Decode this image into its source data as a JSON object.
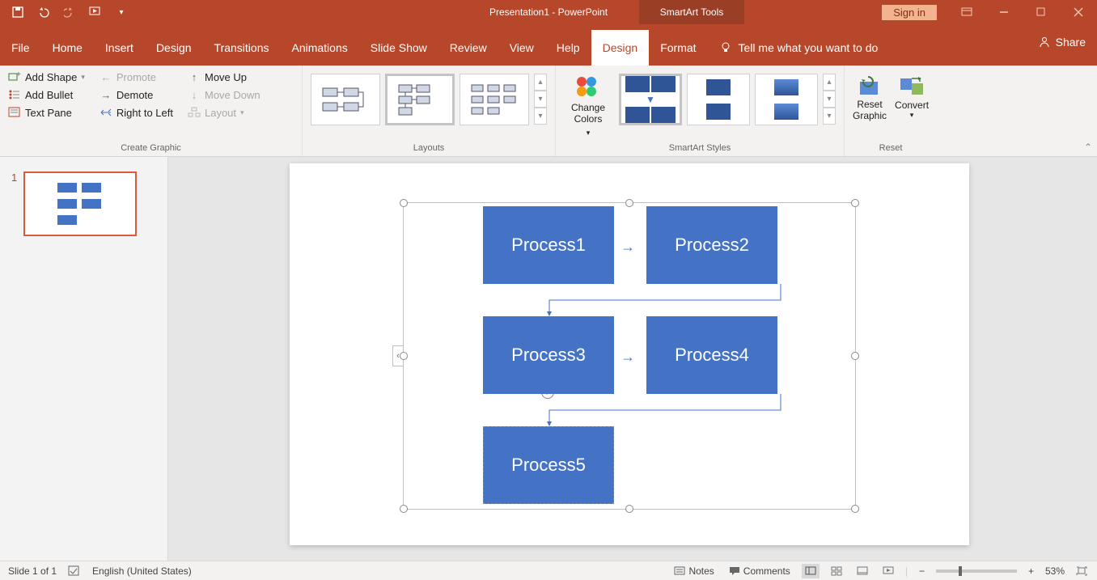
{
  "titlebar": {
    "filename": "Presentation1",
    "app": " - PowerPoint",
    "contextTab": "SmartArt Tools",
    "signin": "Sign in"
  },
  "tabs": {
    "file": "File",
    "home": "Home",
    "insert": "Insert",
    "design_main": "Design",
    "transitions": "Transitions",
    "animations": "Animations",
    "slideshow": "Slide Show",
    "review": "Review",
    "view": "View",
    "help": "Help",
    "sa_design": "Design",
    "sa_format": "Format",
    "tellme": "Tell me what you want to do",
    "share": "Share"
  },
  "ribbon": {
    "createGraphic": {
      "label": "Create Graphic",
      "addShape": "Add Shape",
      "addBullet": "Add Bullet",
      "textPane": "Text Pane",
      "promote": "Promote",
      "demote": "Demote",
      "rightToLeft": "Right to Left",
      "moveUp": "Move Up",
      "moveDown": "Move Down",
      "layout": "Layout"
    },
    "layouts": {
      "label": "Layouts"
    },
    "styles": {
      "label": "SmartArt Styles",
      "changeColors": "Change\nColors"
    },
    "reset": {
      "label": "Reset",
      "resetGraphic": "Reset\nGraphic",
      "convert": "Convert"
    }
  },
  "smartart": {
    "p1": "Process1",
    "p2": "Process2",
    "p3": "Process3",
    "p4": "Process4",
    "p5": "Process5"
  },
  "thumbs": {
    "n1": "1"
  },
  "status": {
    "slide": "Slide 1 of 1",
    "lang": "English (United States)",
    "notes": "Notes",
    "comments": "Comments",
    "zoom": "53%"
  }
}
